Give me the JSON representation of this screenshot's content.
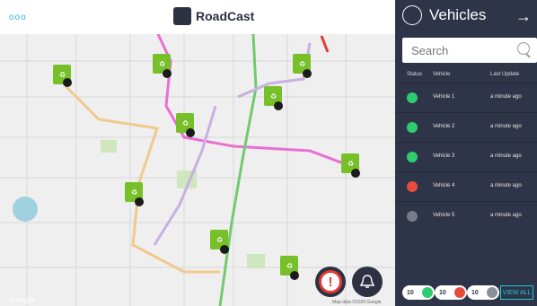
{
  "app": {
    "menu_dots": "ooo",
    "brand_name": "RoadCast"
  },
  "map": {
    "attribution": "Google",
    "footer": "Map data ©2020 Google"
  },
  "panel": {
    "title": "Vehicles",
    "search_placeholder": "Search",
    "columns": {
      "status": "Status",
      "vehicle": "Vehicle",
      "last_update": "Last Update"
    },
    "vehicles": [
      {
        "name": "Vehicle 1",
        "updated": "a minute ago",
        "status": "active",
        "color": "#2ecc71"
      },
      {
        "name": "Vehicle 2",
        "updated": "a minute ago",
        "status": "active",
        "color": "#2ecc71"
      },
      {
        "name": "Vehicle 3",
        "updated": "a minute ago",
        "status": "active",
        "color": "#2ecc71"
      },
      {
        "name": "Vehicle 4",
        "updated": "a minute ago",
        "status": "stopped",
        "color": "#e74c3c"
      },
      {
        "name": "Vehicle 5",
        "updated": "a minute ago",
        "status": "offline",
        "color": "#8a8f99"
      }
    ],
    "counts": {
      "active": "10",
      "stopped": "10",
      "offline": "10"
    },
    "view_all": "VIEW ALL"
  }
}
